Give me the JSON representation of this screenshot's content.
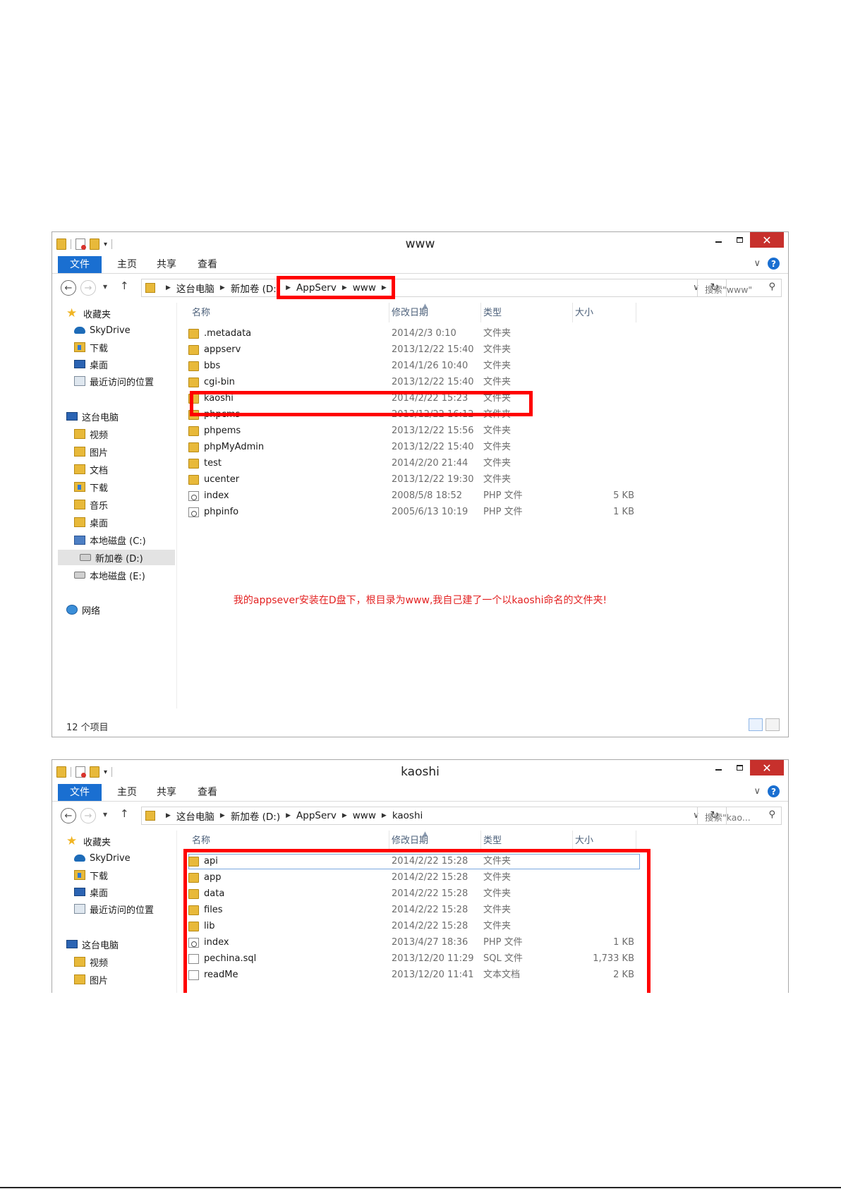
{
  "windows": [
    {
      "title": "www",
      "ribbon_tabs": [
        "文件",
        "主页",
        "共享",
        "查看"
      ],
      "breadcrumb": [
        "这台电脑",
        "新加卷 (D:)",
        "AppServ",
        "www"
      ],
      "search_placeholder": "搜索\"www\"",
      "columns": [
        "名称",
        "修改日期",
        "类型",
        "大小"
      ],
      "files": [
        {
          "name": ".metadata",
          "date": "2014/2/3 0:10",
          "type": "文件夹",
          "size": "",
          "icon": "folder-icon"
        },
        {
          "name": "appserv",
          "date": "2013/12/22 15:40",
          "type": "文件夹",
          "size": "",
          "icon": "folder-icon"
        },
        {
          "name": "bbs",
          "date": "2014/1/26 10:40",
          "type": "文件夹",
          "size": "",
          "icon": "folder-icon"
        },
        {
          "name": "cgi-bin",
          "date": "2013/12/22 15:40",
          "type": "文件夹",
          "size": "",
          "icon": "folder-icon"
        },
        {
          "name": "kaoshi",
          "date": "2014/2/22 15:23",
          "type": "文件夹",
          "size": "",
          "icon": "folder-icon"
        },
        {
          "name": "phpcms",
          "date": "2013/12/22 16:12",
          "type": "文件夹",
          "size": "",
          "icon": "folder-icon"
        },
        {
          "name": "phpems",
          "date": "2013/12/22 15:56",
          "type": "文件夹",
          "size": "",
          "icon": "folder-icon"
        },
        {
          "name": "phpMyAdmin",
          "date": "2013/12/22 15:40",
          "type": "文件夹",
          "size": "",
          "icon": "folder-icon"
        },
        {
          "name": "test",
          "date": "2014/2/20 21:44",
          "type": "文件夹",
          "size": "",
          "icon": "folder-icon"
        },
        {
          "name": "ucenter",
          "date": "2013/12/22 19:30",
          "type": "文件夹",
          "size": "",
          "icon": "folder-icon"
        },
        {
          "name": "index",
          "date": "2008/5/8 18:52",
          "type": "PHP 文件",
          "size": "5 KB",
          "icon": "php-file-icon"
        },
        {
          "name": "phpinfo",
          "date": "2005/6/13 10:19",
          "type": "PHP 文件",
          "size": "1 KB",
          "icon": "php-file-icon"
        }
      ],
      "status": "12 个项目",
      "annotation": "我的appsever安装在D盘下，根目录为www,我自己建了一个以kaoshi命名的文件夹!"
    },
    {
      "title": "kaoshi",
      "ribbon_tabs": [
        "文件",
        "主页",
        "共享",
        "查看"
      ],
      "breadcrumb": [
        "这台电脑",
        "新加卷 (D:)",
        "AppServ",
        "www",
        "kaoshi"
      ],
      "search_placeholder": "搜索\"kao...",
      "columns": [
        "名称",
        "修改日期",
        "类型",
        "大小"
      ],
      "files": [
        {
          "name": "api",
          "date": "2014/2/22 15:28",
          "type": "文件夹",
          "size": "",
          "icon": "folder-icon"
        },
        {
          "name": "app",
          "date": "2014/2/22 15:28",
          "type": "文件夹",
          "size": "",
          "icon": "folder-icon"
        },
        {
          "name": "data",
          "date": "2014/2/22 15:28",
          "type": "文件夹",
          "size": "",
          "icon": "folder-icon"
        },
        {
          "name": "files",
          "date": "2014/2/22 15:28",
          "type": "文件夹",
          "size": "",
          "icon": "folder-icon"
        },
        {
          "name": "lib",
          "date": "2014/2/22 15:28",
          "type": "文件夹",
          "size": "",
          "icon": "folder-icon"
        },
        {
          "name": "index",
          "date": "2013/4/27 18:36",
          "type": "PHP 文件",
          "size": "1 KB",
          "icon": "php-file-icon"
        },
        {
          "name": "pechina.sql",
          "date": "2013/12/20 11:29",
          "type": "SQL 文件",
          "size": "1,733 KB",
          "icon": "sql-file-icon"
        },
        {
          "name": "readMe",
          "date": "2013/12/20 11:41",
          "type": "文本文档",
          "size": "2 KB",
          "icon": "text-file-icon"
        }
      ]
    }
  ],
  "nav_pane": {
    "favorites": "收藏夹",
    "skydrive": "SkyDrive",
    "downloads": "下载",
    "desktop": "桌面",
    "recent": "最近访问的位置",
    "this_pc": "这台电脑",
    "videos": "视频",
    "pictures": "图片",
    "documents": "文档",
    "music": "音乐",
    "drive_c": "本地磁盘 (C:)",
    "drive_d": "新加卷 (D:)",
    "drive_e": "本地磁盘 (E:)",
    "network": "网络"
  },
  "colors": {
    "accent": "#1a6fd1",
    "highlight": "#ff0000",
    "annotation_text": "#e32222",
    "close_button": "#c7302c"
  }
}
